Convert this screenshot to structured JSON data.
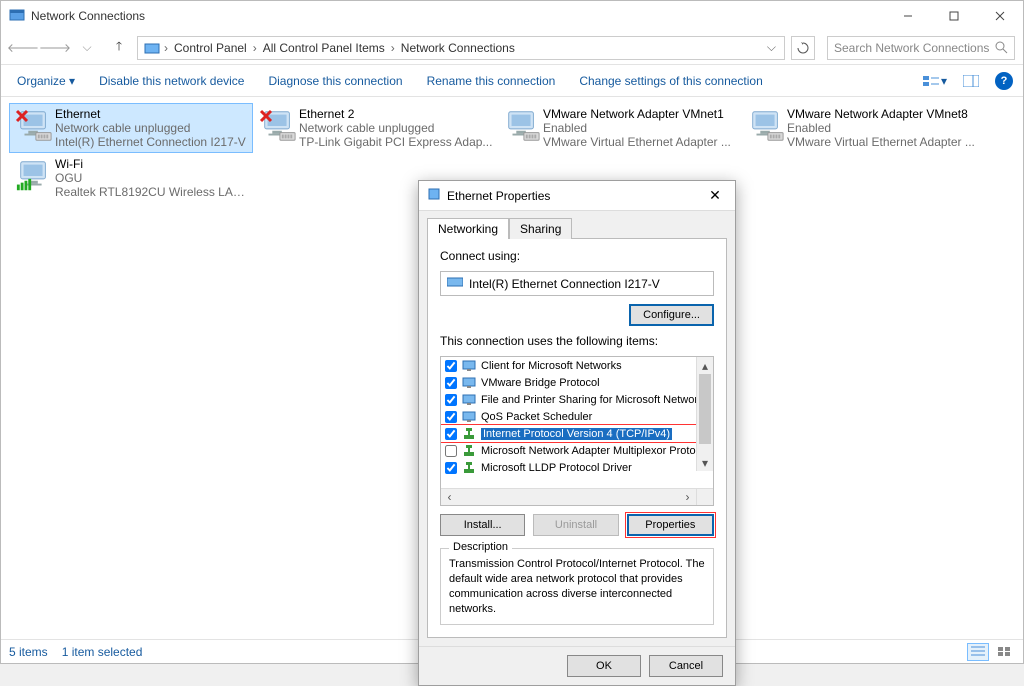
{
  "window": {
    "title": "Network Connections"
  },
  "breadcrumb": {
    "items": [
      "Control Panel",
      "All Control Panel Items",
      "Network Connections"
    ]
  },
  "search": {
    "placeholder": "Search Network Connections"
  },
  "toolbar": {
    "organize": "Organize",
    "disable": "Disable this network device",
    "diagnose": "Diagnose this connection",
    "rename": "Rename this connection",
    "change": "Change settings of this connection"
  },
  "adapters": [
    {
      "name": "Ethernet",
      "status": "Network cable unplugged",
      "device": "Intel(R) Ethernet Connection I217-V",
      "unplugged": true,
      "selected": true,
      "type": "eth"
    },
    {
      "name": "Ethernet 2",
      "status": "Network cable unplugged",
      "device": "TP-Link Gigabit PCI Express Adap...",
      "unplugged": true,
      "selected": false,
      "type": "eth"
    },
    {
      "name": "VMware Network Adapter VMnet1",
      "status": "Enabled",
      "device": "VMware Virtual Ethernet Adapter ...",
      "unplugged": false,
      "selected": false,
      "type": "eth"
    },
    {
      "name": "VMware Network Adapter VMnet8",
      "status": "Enabled",
      "device": "VMware Virtual Ethernet Adapter ...",
      "unplugged": false,
      "selected": false,
      "type": "eth"
    },
    {
      "name": "Wi-Fi",
      "status": "OGU",
      "device": "Realtek RTL8192CU Wireless LAN ...",
      "unplugged": false,
      "selected": false,
      "type": "wifi"
    }
  ],
  "statusbar": {
    "count": "5 items",
    "selected": "1 item selected"
  },
  "dialog": {
    "title": "Ethernet Properties",
    "tabs": {
      "networking": "Networking",
      "sharing": "Sharing"
    },
    "connect_using_label": "Connect using:",
    "adapter_name": "Intel(R) Ethernet Connection I217-V",
    "configure": "Configure...",
    "items_label": "This connection uses the following items:",
    "components": [
      {
        "label": "Client for Microsoft Networks",
        "checked": true,
        "icon": "client",
        "selected": false
      },
      {
        "label": "VMware Bridge Protocol",
        "checked": true,
        "icon": "client",
        "selected": false
      },
      {
        "label": "File and Printer Sharing for Microsoft Networks",
        "checked": true,
        "icon": "service",
        "selected": false
      },
      {
        "label": "QoS Packet Scheduler",
        "checked": true,
        "icon": "service",
        "selected": false
      },
      {
        "label": "Internet Protocol Version 4 (TCP/IPv4)",
        "checked": true,
        "icon": "protocol",
        "selected": true
      },
      {
        "label": "Microsoft Network Adapter Multiplexor Protocol",
        "checked": false,
        "icon": "protocol",
        "selected": false
      },
      {
        "label": "Microsoft LLDP Protocol Driver",
        "checked": true,
        "icon": "protocol",
        "selected": false
      }
    ],
    "install": "Install...",
    "uninstall": "Uninstall",
    "properties": "Properties",
    "description_label": "Description",
    "description_text": "Transmission Control Protocol/Internet Protocol. The default wide area network protocol that provides communication across diverse interconnected networks.",
    "ok": "OK",
    "cancel": "Cancel"
  }
}
